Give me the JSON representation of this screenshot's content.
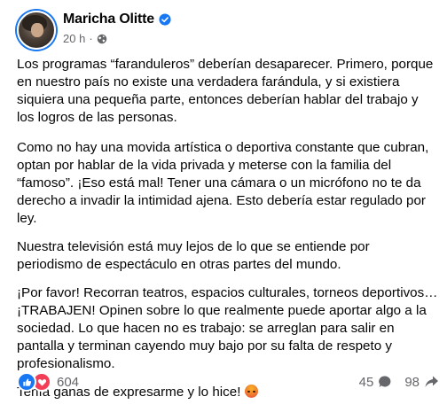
{
  "author": {
    "name": "Maricha Olitte",
    "time": "20 h",
    "separator": "·"
  },
  "post": {
    "paragraphs": [
      "Los programas “faranduleros” deberían desaparecer. Primero, porque en nuestro país no existe una verdadera farándula, y si existiera siquiera una pequeña parte, entonces deberían hablar del trabajo y los logros de las personas.",
      "Como no hay una movida artística o deportiva constante que cubran, optan por hablar de la vida privada y meterse con la familia del “famoso”. ¡Eso está mal! Tener una cámara o un micrófono no te da derecho a invadir la intimidad ajena. Esto debería estar regulado por ley.",
      "Nuestra televisión está muy lejos de lo que se entiende por periodismo de espectáculo en otras partes del mundo.",
      "¡Por favor! Recorran teatros, espacios culturales, torneos deportivos… ¡TRABAJEN! Opinen sobre lo que realmente puede aportar algo a la sociedad. Lo que hacen no es trabajo: se arreglan para salir en pantalla y terminan cayendo muy bajo por su falta de respeto y profesionalismo.",
      "Tenía ganas de expresarme y lo hice!"
    ]
  },
  "stats": {
    "reactions": "604",
    "comments": "45",
    "shares": "98"
  },
  "colors": {
    "facebook_blue": "#1877f2",
    "love_red": "#f33e58",
    "secondary_text": "#65676b"
  },
  "icons": [
    "verified-badge-icon",
    "globe-icon",
    "like-reaction-icon",
    "love-reaction-icon",
    "angry-emoji-icon",
    "comment-icon",
    "share-icon"
  ]
}
